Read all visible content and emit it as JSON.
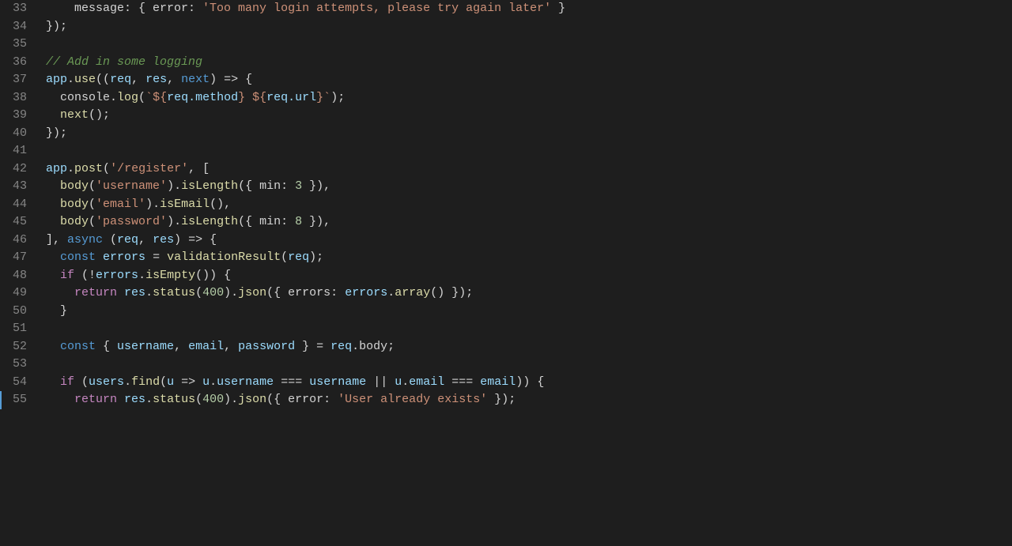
{
  "editor": {
    "background": "#1e1e1e",
    "lines": [
      {
        "num": "33",
        "tokens": [
          {
            "type": "plain",
            "text": "    message: { error: "
          },
          {
            "type": "str",
            "text": "'Too many login attempts, please try again later'"
          },
          {
            "type": "plain",
            "text": " }"
          }
        ]
      },
      {
        "num": "34",
        "tokens": [
          {
            "type": "plain",
            "text": "});"
          }
        ]
      },
      {
        "num": "35",
        "tokens": []
      },
      {
        "num": "36",
        "tokens": [
          {
            "type": "comment",
            "text": "// Add in some logging"
          }
        ]
      },
      {
        "num": "37",
        "tokens": [
          {
            "type": "app",
            "text": "app"
          },
          {
            "type": "plain",
            "text": "."
          },
          {
            "type": "method",
            "text": "use"
          },
          {
            "type": "plain",
            "text": "(("
          },
          {
            "type": "param",
            "text": "req"
          },
          {
            "type": "plain",
            "text": ", "
          },
          {
            "type": "param",
            "text": "res"
          },
          {
            "type": "plain",
            "text": ", "
          },
          {
            "type": "next-kw",
            "text": "next"
          },
          {
            "type": "plain",
            "text": ") => {"
          }
        ]
      },
      {
        "num": "38",
        "tokens": [
          {
            "type": "plain",
            "text": "  console."
          },
          {
            "type": "method",
            "text": "log"
          },
          {
            "type": "plain",
            "text": "("
          },
          {
            "type": "str",
            "text": "`"
          },
          {
            "type": "str",
            "text": "${"
          },
          {
            "type": "prop",
            "text": "req.method"
          },
          {
            "type": "str",
            "text": "}"
          },
          {
            "type": "plain",
            "text": " "
          },
          {
            "type": "str",
            "text": "${"
          },
          {
            "type": "prop",
            "text": "req.url"
          },
          {
            "type": "str",
            "text": "}"
          },
          {
            "type": "str",
            "text": "`"
          },
          {
            "type": "plain",
            "text": ");"
          }
        ]
      },
      {
        "num": "39",
        "tokens": [
          {
            "type": "plain",
            "text": "  "
          },
          {
            "type": "method",
            "text": "next"
          },
          {
            "type": "plain",
            "text": "();"
          }
        ]
      },
      {
        "num": "40",
        "tokens": [
          {
            "type": "plain",
            "text": "});"
          }
        ]
      },
      {
        "num": "41",
        "tokens": []
      },
      {
        "num": "42",
        "tokens": [
          {
            "type": "app",
            "text": "app"
          },
          {
            "type": "plain",
            "text": "."
          },
          {
            "type": "method",
            "text": "post"
          },
          {
            "type": "plain",
            "text": "("
          },
          {
            "type": "str",
            "text": "'/register'"
          },
          {
            "type": "plain",
            "text": ", ["
          }
        ]
      },
      {
        "num": "43",
        "tokens": [
          {
            "type": "plain",
            "text": "  "
          },
          {
            "type": "method",
            "text": "body"
          },
          {
            "type": "plain",
            "text": "("
          },
          {
            "type": "str",
            "text": "'username'"
          },
          {
            "type": "plain",
            "text": ")."
          },
          {
            "type": "method",
            "text": "isLength"
          },
          {
            "type": "plain",
            "text": "({ min: "
          },
          {
            "type": "num",
            "text": "3"
          },
          {
            "type": "plain",
            "text": " }),"
          }
        ]
      },
      {
        "num": "44",
        "tokens": [
          {
            "type": "plain",
            "text": "  "
          },
          {
            "type": "method",
            "text": "body"
          },
          {
            "type": "plain",
            "text": "("
          },
          {
            "type": "str",
            "text": "'email'"
          },
          {
            "type": "plain",
            "text": ")."
          },
          {
            "type": "method",
            "text": "isEmail"
          },
          {
            "type": "plain",
            "text": "(),"
          }
        ]
      },
      {
        "num": "45",
        "tokens": [
          {
            "type": "plain",
            "text": "  "
          },
          {
            "type": "method",
            "text": "body"
          },
          {
            "type": "plain",
            "text": "("
          },
          {
            "type": "str",
            "text": "'password'"
          },
          {
            "type": "plain",
            "text": ")."
          },
          {
            "type": "method",
            "text": "isLength"
          },
          {
            "type": "plain",
            "text": "({ min: "
          },
          {
            "type": "num",
            "text": "8"
          },
          {
            "type": "plain",
            "text": " }),"
          }
        ]
      },
      {
        "num": "46",
        "tokens": [
          {
            "type": "plain",
            "text": "], "
          },
          {
            "type": "kw",
            "text": "async"
          },
          {
            "type": "plain",
            "text": " ("
          },
          {
            "type": "param",
            "text": "req"
          },
          {
            "type": "plain",
            "text": ", "
          },
          {
            "type": "param",
            "text": "res"
          },
          {
            "type": "plain",
            "text": ") => {"
          }
        ]
      },
      {
        "num": "47",
        "tokens": [
          {
            "type": "plain",
            "text": "  "
          },
          {
            "type": "kw",
            "text": "const"
          },
          {
            "type": "plain",
            "text": " "
          },
          {
            "type": "var",
            "text": "errors"
          },
          {
            "type": "plain",
            "text": " = "
          },
          {
            "type": "method",
            "text": "validationResult"
          },
          {
            "type": "plain",
            "text": "("
          },
          {
            "type": "param",
            "text": "req"
          },
          {
            "type": "plain",
            "text": ");"
          }
        ]
      },
      {
        "num": "48",
        "tokens": [
          {
            "type": "plain",
            "text": "  "
          },
          {
            "type": "kw-control",
            "text": "if"
          },
          {
            "type": "plain",
            "text": " (!"
          },
          {
            "type": "var",
            "text": "errors"
          },
          {
            "type": "plain",
            "text": "."
          },
          {
            "type": "method",
            "text": "isEmpty"
          },
          {
            "type": "plain",
            "text": "()) {"
          }
        ]
      },
      {
        "num": "49",
        "tokens": [
          {
            "type": "plain",
            "text": "    "
          },
          {
            "type": "kw-control",
            "text": "return"
          },
          {
            "type": "plain",
            "text": " "
          },
          {
            "type": "param",
            "text": "res"
          },
          {
            "type": "plain",
            "text": "."
          },
          {
            "type": "method",
            "text": "status"
          },
          {
            "type": "plain",
            "text": "("
          },
          {
            "type": "num",
            "text": "400"
          },
          {
            "type": "plain",
            "text": ")."
          },
          {
            "type": "method",
            "text": "json"
          },
          {
            "type": "plain",
            "text": "({ errors: "
          },
          {
            "type": "var",
            "text": "errors"
          },
          {
            "type": "plain",
            "text": "."
          },
          {
            "type": "method",
            "text": "array"
          },
          {
            "type": "plain",
            "text": "() });"
          }
        ]
      },
      {
        "num": "50",
        "tokens": [
          {
            "type": "plain",
            "text": "  }"
          }
        ]
      },
      {
        "num": "51",
        "tokens": []
      },
      {
        "num": "52",
        "tokens": [
          {
            "type": "plain",
            "text": "  "
          },
          {
            "type": "kw",
            "text": "const"
          },
          {
            "type": "plain",
            "text": " { "
          },
          {
            "type": "var",
            "text": "username"
          },
          {
            "type": "plain",
            "text": ", "
          },
          {
            "type": "var",
            "text": "email"
          },
          {
            "type": "plain",
            "text": ", "
          },
          {
            "type": "var",
            "text": "password"
          },
          {
            "type": "plain",
            "text": " } = "
          },
          {
            "type": "param",
            "text": "req"
          },
          {
            "type": "plain",
            "text": ".body;"
          }
        ]
      },
      {
        "num": "53",
        "tokens": []
      },
      {
        "num": "54",
        "tokens": [
          {
            "type": "plain",
            "text": "  "
          },
          {
            "type": "kw-control",
            "text": "if"
          },
          {
            "type": "plain",
            "text": " ("
          },
          {
            "type": "var",
            "text": "users"
          },
          {
            "type": "plain",
            "text": "."
          },
          {
            "type": "method",
            "text": "find"
          },
          {
            "type": "plain",
            "text": "("
          },
          {
            "type": "param",
            "text": "u"
          },
          {
            "type": "plain",
            "text": " => "
          },
          {
            "type": "param",
            "text": "u"
          },
          {
            "type": "plain",
            "text": "."
          },
          {
            "type": "prop",
            "text": "username"
          },
          {
            "type": "plain",
            "text": " === "
          },
          {
            "type": "var",
            "text": "username"
          },
          {
            "type": "plain",
            "text": " || "
          },
          {
            "type": "param",
            "text": "u"
          },
          {
            "type": "plain",
            "text": "."
          },
          {
            "type": "prop",
            "text": "email"
          },
          {
            "type": "plain",
            "text": " === "
          },
          {
            "type": "var",
            "text": "email"
          },
          {
            "type": "plain",
            "text": ")) {"
          }
        ]
      },
      {
        "num": "55",
        "tokens": [
          {
            "type": "plain",
            "text": "    "
          },
          {
            "type": "kw-control",
            "text": "return"
          },
          {
            "type": "plain",
            "text": " "
          },
          {
            "type": "param",
            "text": "res"
          },
          {
            "type": "plain",
            "text": "."
          },
          {
            "type": "method",
            "text": "status"
          },
          {
            "type": "plain",
            "text": "("
          },
          {
            "type": "num",
            "text": "400"
          },
          {
            "type": "plain",
            "text": ")."
          },
          {
            "type": "method",
            "text": "json"
          },
          {
            "type": "plain",
            "text": "({ error: "
          },
          {
            "type": "str",
            "text": "'User already exists'"
          },
          {
            "type": "plain",
            "text": " });"
          }
        ],
        "hasBar": true
      }
    ]
  }
}
